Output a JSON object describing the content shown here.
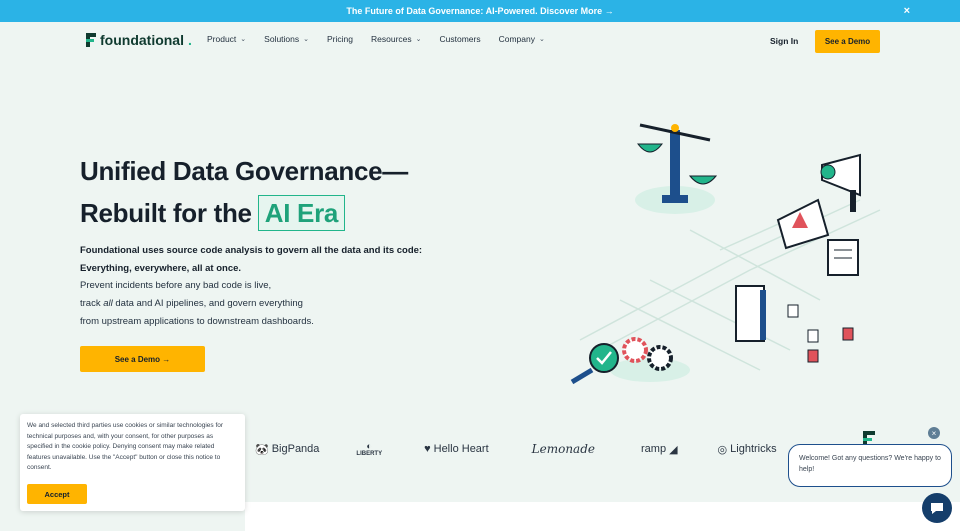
{
  "announcement": {
    "text": "The Future of Data Governance: AI-Powered. Discover More →",
    "close": "×"
  },
  "nav": {
    "brand": "foundational",
    "brand_dot": ".",
    "menu": [
      {
        "label": "Product",
        "chevron": true
      },
      {
        "label": "Solutions",
        "chevron": true
      },
      {
        "label": "Pricing",
        "chevron": false
      },
      {
        "label": "Resources",
        "chevron": true
      },
      {
        "label": "Customers",
        "chevron": false
      },
      {
        "label": "Company",
        "chevron": true
      }
    ],
    "signin": "Sign In",
    "demo": "See a Demo"
  },
  "hero": {
    "title_line1": "Unified Data Governance—",
    "title_line2": "Rebuilt for the",
    "title_highlight": "AI Era",
    "lead_line1": "Foundational uses source code analysis to govern all the data and its code:",
    "lead_line2": "Everything, everywhere, all at once.",
    "sub_line1": "Prevent incidents before any bad code is live,",
    "sub_line2_pre": "track ",
    "sub_line2_em": "all",
    "sub_line2_post": " data and AI pipelines, and govern everything",
    "sub_line3": "from upstream applications to downstream dashboards.",
    "cta": "See a Demo →"
  },
  "logos": [
    "BigPanda",
    "LIBERTY",
    "Hello Heart",
    "Lemonade",
    "ramp",
    "Lightricks"
  ],
  "cookie": {
    "text": "We and selected third parties use cookies or similar technologies for technical purposes and, with your consent, for other purposes as specified in the cookie policy. Denying consent may make related features unavailable. Use the \"Accept\" button or close this notice to consent.",
    "accept": "Accept"
  },
  "chat": {
    "message": "Welcome! Got any questions? We're happy to help!",
    "close": "×"
  },
  "colors": {
    "accent": "#ffb400",
    "brand_green": "#22b58b",
    "banner": "#2bb3e6",
    "dark": "#16202b"
  }
}
